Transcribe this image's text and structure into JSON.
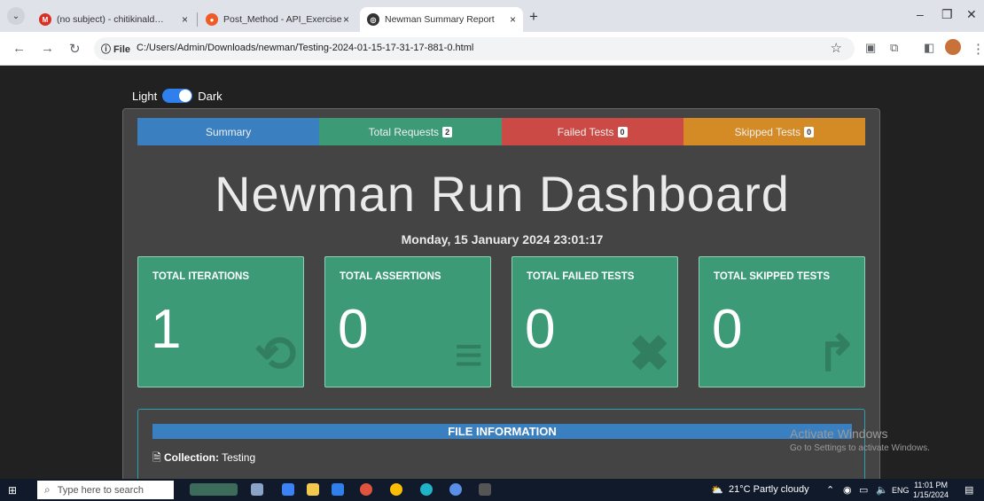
{
  "browser": {
    "tabs": [
      {
        "title": "(no subject) - chitikinald@gma",
        "close": "×"
      },
      {
        "title": "Post_Method - API_Exercise",
        "close": "×"
      },
      {
        "title": "Newman Summary Report",
        "close": "×"
      }
    ],
    "new_tab": "+",
    "window_controls": {
      "minimize": "–",
      "restore": "❐",
      "close": "✕"
    },
    "address": {
      "scheme_label": "ⓘ File",
      "url": "C:/Users/Admin/Downloads/newman/Testing-2024-01-15-17-31-17-881-0.html"
    }
  },
  "page": {
    "theme_toggle": {
      "left": "Light",
      "right": "Dark"
    },
    "nav": [
      {
        "label": "Summary",
        "badge": "",
        "color": "#3a7fc0"
      },
      {
        "label": "Total Requests",
        "badge": "2",
        "color": "#3c9b76"
      },
      {
        "label": "Failed Tests",
        "badge": "0",
        "color": "#cc4a45"
      },
      {
        "label": "Skipped Tests",
        "badge": "0",
        "color": "#d48b25"
      }
    ],
    "title": "Newman Run Dashboard",
    "timestamp": "Monday, 15 January 2024 23:01:17",
    "cards": [
      {
        "label": "TOTAL ITERATIONS",
        "value": "1",
        "icon": "sync-icon",
        "glyph": "⟲"
      },
      {
        "label": "TOTAL ASSERTIONS",
        "value": "0",
        "icon": "tasks-icon",
        "glyph": "≡"
      },
      {
        "label": "TOTAL FAILED TESTS",
        "value": "0",
        "icon": "times-circle-icon",
        "glyph": "✖"
      },
      {
        "label": "TOTAL SKIPPED TESTS",
        "value": "0",
        "icon": "share-icon",
        "glyph": "↱"
      }
    ],
    "file_info": {
      "heading": "FILE INFORMATION",
      "collection_label": "Collection:",
      "collection_value": "Testing"
    }
  },
  "watermark": {
    "line1": "Activate Windows",
    "line2": "Go to Settings to activate Windows."
  },
  "taskbar": {
    "search_placeholder": "Type here to search",
    "weather": "21°C  Partly cloudy",
    "language": "ENG",
    "time": "11:01 PM",
    "date": "1/15/2024"
  }
}
